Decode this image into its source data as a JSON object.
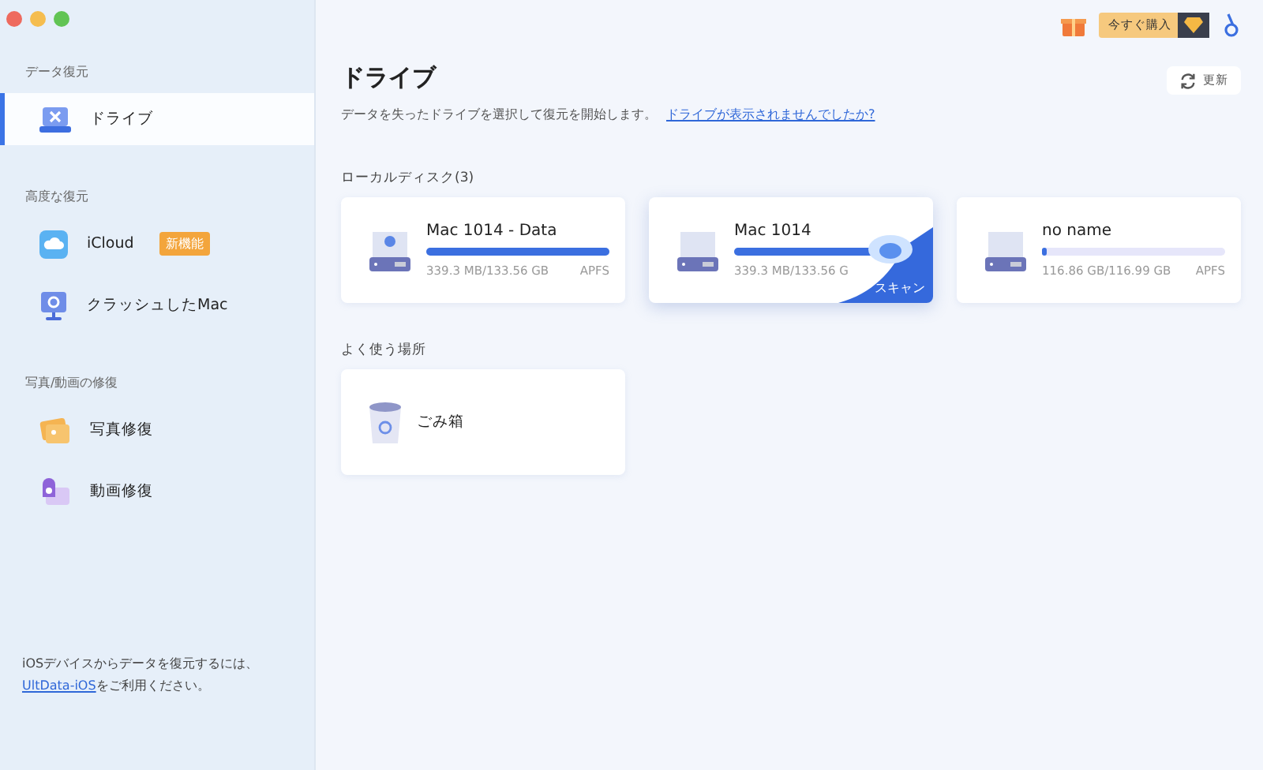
{
  "sidebar": {
    "sections": [
      {
        "title": "データ復元",
        "items": [
          {
            "label": "ドライブ",
            "kind": "drive",
            "selected": true
          }
        ]
      },
      {
        "title": "高度な復元",
        "items": [
          {
            "label": "iCloud",
            "kind": "cloud",
            "selected": false,
            "badge": "新機能"
          },
          {
            "label": "クラッシュしたMac",
            "kind": "monitor",
            "selected": false
          }
        ]
      },
      {
        "title": "写真/動画の修復",
        "items": [
          {
            "label": "写真修復",
            "kind": "photo",
            "selected": false
          },
          {
            "label": "動画修復",
            "kind": "video",
            "selected": false
          }
        ]
      }
    ],
    "footer": {
      "text": "iOSデバイスからデータを復元するには、",
      "link": "UltData-iOS",
      "text_after": "をご利用ください。"
    }
  },
  "toolbar": {
    "buy_button": "今すぐ購入"
  },
  "main": {
    "title": "ドライブ",
    "subtitle": "データを失ったドライブを選択して復元を開始します。",
    "help_link": "ドライブが表示されませんでしたか?",
    "refresh_button": "更新"
  },
  "local_disks": {
    "title": "ローカルディスク(3)",
    "drives": [
      {
        "name": "Mac 1014 - Data",
        "kind": "apple",
        "level": 1,
        "size": "339.3 MB/133.56 GB",
        "filesystem": "APFS",
        "selected": false
      },
      {
        "name": "Mac 1014",
        "kind": "plain",
        "level": 1,
        "size": "339.3 MB/133.56 G",
        "selected": true,
        "scan_label": "スキャン"
      },
      {
        "name": "no name",
        "kind": "plain",
        "level": 0,
        "size": "116.86 GB/116.99 GB",
        "filesystem": "APFS",
        "selected": false
      }
    ]
  },
  "favorites": {
    "title": "よく使う場所",
    "items": [
      {
        "name": "ごみ箱"
      }
    ]
  }
}
